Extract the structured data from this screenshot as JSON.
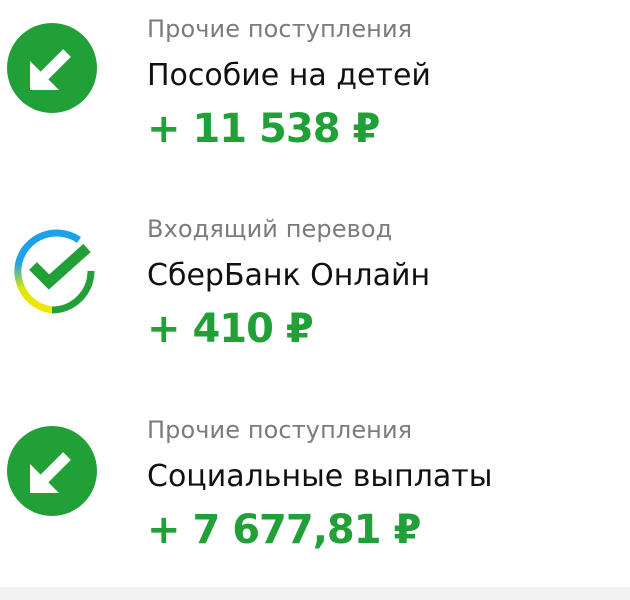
{
  "transactions": [
    {
      "category": "Прочие поступления",
      "title": "Пособие на детей",
      "amount": "+ 11 538 ₽",
      "icon": "incoming-arrow-icon"
    },
    {
      "category": "Входящий перевод",
      "title": "СберБанк Онлайн",
      "amount": "+ 410 ₽",
      "icon": "sberbank-logo-icon"
    },
    {
      "category": "Прочие поступления",
      "title": "Социальные выплаты",
      "amount": "+ 7 677,81 ₽",
      "icon": "incoming-arrow-icon"
    }
  ],
  "colors": {
    "income_green": "#21a038",
    "category_gray": "#7c7c7c",
    "title_black": "#111111"
  }
}
